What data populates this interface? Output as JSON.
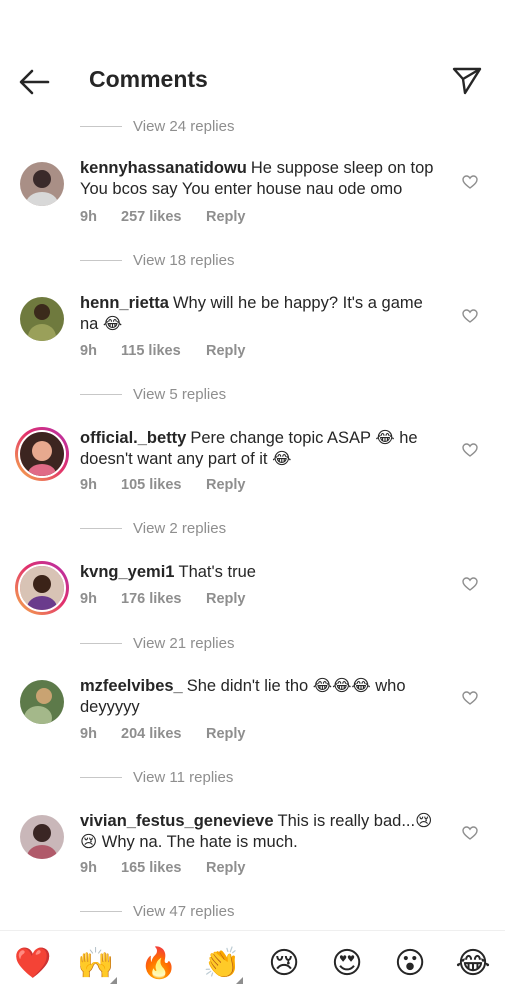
{
  "header": {
    "title": "Comments"
  },
  "threads": [
    {
      "view_replies": "View 24 replies"
    },
    {
      "username": "kennyhassanatidowu",
      "text": "He suppose sleep on top You bcos say You enter house nau ode omo",
      "time": "9h",
      "likes": "257 likes",
      "reply": "Reply",
      "view_replies": "View 18 replies",
      "avatar": {
        "bg": "#a98f86",
        "fg": "#3a2a2a",
        "ring": false
      }
    },
    {
      "username": "henn_rietta",
      "text": "Why will he be happy? It's a game na 😂",
      "time": "9h",
      "likes": "115 likes",
      "reply": "Reply",
      "view_replies": "View 5 replies",
      "avatar": {
        "bg": "#6f7a3e",
        "fg": "#3b2a1b",
        "ring": false
      }
    },
    {
      "username": "official._betty",
      "text": "Pere change topic ASAP 😂 he doesn't want any part of it 😂",
      "time": "9h",
      "likes": "105 likes",
      "reply": "Reply",
      "view_replies": "View 2 replies",
      "avatar": {
        "bg": "#3c2520",
        "fg": "#e7a98f",
        "ring": true
      }
    },
    {
      "username": "kvng_yemi1",
      "text": "That's true",
      "time": "9h",
      "likes": "176 likes",
      "reply": "Reply",
      "view_replies": "View 21 replies",
      "avatar": {
        "bg": "#d8c3b5",
        "fg": "#3b2318",
        "ring": true
      }
    },
    {
      "username": "mzfeelvibes_",
      "text": "She didn't lie tho 😂😂😂 who deyyyyy",
      "time": "9h",
      "likes": "204 likes",
      "reply": "Reply",
      "view_replies": "View 11 replies",
      "avatar": {
        "bg": "#5d7a4a",
        "fg": "#c9a372",
        "ring": false
      }
    },
    {
      "username": "vivian_festus_genevieve",
      "text": "This is really bad...😢😢 Why na. The hate is much.",
      "time": "9h",
      "likes": "165 likes",
      "reply": "Reply",
      "view_replies": "View 47 replies",
      "avatar": {
        "bg": "#c9b7b9",
        "fg": "#3a2624",
        "ring": false
      }
    }
  ],
  "emoji_bar": [
    {
      "glyph": "❤️",
      "name": "red-heart",
      "caret": false
    },
    {
      "glyph": "🙌",
      "name": "raising-hands",
      "caret": true
    },
    {
      "glyph": "🔥",
      "name": "fire",
      "caret": false
    },
    {
      "glyph": "👏",
      "name": "clapping-hands",
      "caret": true
    },
    {
      "glyph": "😢",
      "name": "crying-face",
      "caret": false
    },
    {
      "glyph": "😍",
      "name": "heart-eyes",
      "caret": false
    },
    {
      "glyph": "😮",
      "name": "open-mouth-face",
      "caret": false
    },
    {
      "glyph": "😂",
      "name": "tears-of-joy",
      "caret": false
    }
  ]
}
